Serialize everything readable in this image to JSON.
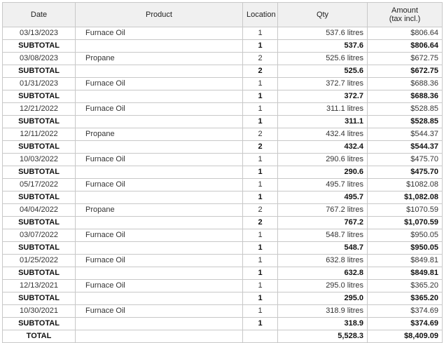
{
  "table": {
    "headers": {
      "date": "Date",
      "product": "Product",
      "location": "Location",
      "qty": "Qty",
      "amount_line1": "Amount",
      "amount_line2": "(tax incl.)"
    },
    "rows": [
      {
        "type": "item",
        "date": "03/13/2023",
        "product": "Furnace Oil",
        "location": "1",
        "qty": "537.6 litres",
        "amount": "$806.64"
      },
      {
        "type": "subtotal",
        "date": "SUBTOTAL",
        "product": "",
        "location": "1",
        "qty": "537.6",
        "amount": "$806.64"
      },
      {
        "type": "item",
        "date": "03/08/2023",
        "product": "Propane",
        "location": "2",
        "qty": "525.6 litres",
        "amount": "$672.75"
      },
      {
        "type": "subtotal",
        "date": "SUBTOTAL",
        "product": "",
        "location": "2",
        "qty": "525.6",
        "amount": "$672.75"
      },
      {
        "type": "item",
        "date": "01/31/2023",
        "product": "Furnace Oil",
        "location": "1",
        "qty": "372.7 litres",
        "amount": "$688.36"
      },
      {
        "type": "subtotal",
        "date": "SUBTOTAL",
        "product": "",
        "location": "1",
        "qty": "372.7",
        "amount": "$688.36"
      },
      {
        "type": "item",
        "date": "12/21/2022",
        "product": "Furnace Oil",
        "location": "1",
        "qty": "311.1 litres",
        "amount": "$528.85"
      },
      {
        "type": "subtotal",
        "date": "SUBTOTAL",
        "product": "",
        "location": "1",
        "qty": "311.1",
        "amount": "$528.85"
      },
      {
        "type": "item",
        "date": "12/11/2022",
        "product": "Propane",
        "location": "2",
        "qty": "432.4 litres",
        "amount": "$544.37"
      },
      {
        "type": "subtotal",
        "date": "SUBTOTAL",
        "product": "",
        "location": "2",
        "qty": "432.4",
        "amount": "$544.37"
      },
      {
        "type": "item",
        "date": "10/03/2022",
        "product": "Furnace Oil",
        "location": "1",
        "qty": "290.6 litres",
        "amount": "$475.70"
      },
      {
        "type": "subtotal",
        "date": "SUBTOTAL",
        "product": "",
        "location": "1",
        "qty": "290.6",
        "amount": "$475.70"
      },
      {
        "type": "item",
        "date": "05/17/2022",
        "product": "Furnace Oil",
        "location": "1",
        "qty": "495.7 litres",
        "amount": "$1082.08"
      },
      {
        "type": "subtotal",
        "date": "SUBTOTAL",
        "product": "",
        "location": "1",
        "qty": "495.7",
        "amount": "$1,082.08"
      },
      {
        "type": "item",
        "date": "04/04/2022",
        "product": "Propane",
        "location": "2",
        "qty": "767.2 litres",
        "amount": "$1070.59"
      },
      {
        "type": "subtotal",
        "date": "SUBTOTAL",
        "product": "",
        "location": "2",
        "qty": "767.2",
        "amount": "$1,070.59"
      },
      {
        "type": "item",
        "date": "03/07/2022",
        "product": "Furnace Oil",
        "location": "1",
        "qty": "548.7 litres",
        "amount": "$950.05"
      },
      {
        "type": "subtotal",
        "date": "SUBTOTAL",
        "product": "",
        "location": "1",
        "qty": "548.7",
        "amount": "$950.05"
      },
      {
        "type": "item",
        "date": "01/25/2022",
        "product": "Furnace Oil",
        "location": "1",
        "qty": "632.8 litres",
        "amount": "$849.81"
      },
      {
        "type": "subtotal",
        "date": "SUBTOTAL",
        "product": "",
        "location": "1",
        "qty": "632.8",
        "amount": "$849.81"
      },
      {
        "type": "item",
        "date": "12/13/2021",
        "product": "Furnace Oil",
        "location": "1",
        "qty": "295.0 litres",
        "amount": "$365.20"
      },
      {
        "type": "subtotal",
        "date": "SUBTOTAL",
        "product": "",
        "location": "1",
        "qty": "295.0",
        "amount": "$365.20"
      },
      {
        "type": "item",
        "date": "10/30/2021",
        "product": "Furnace Oil",
        "location": "1",
        "qty": "318.9 litres",
        "amount": "$374.69"
      },
      {
        "type": "subtotal",
        "date": "SUBTOTAL",
        "product": "",
        "location": "1",
        "qty": "318.9",
        "amount": "$374.69"
      },
      {
        "type": "total",
        "date": "TOTAL",
        "product": "",
        "location": "",
        "qty": "5,528.3",
        "amount": "$8,409.09"
      }
    ]
  }
}
